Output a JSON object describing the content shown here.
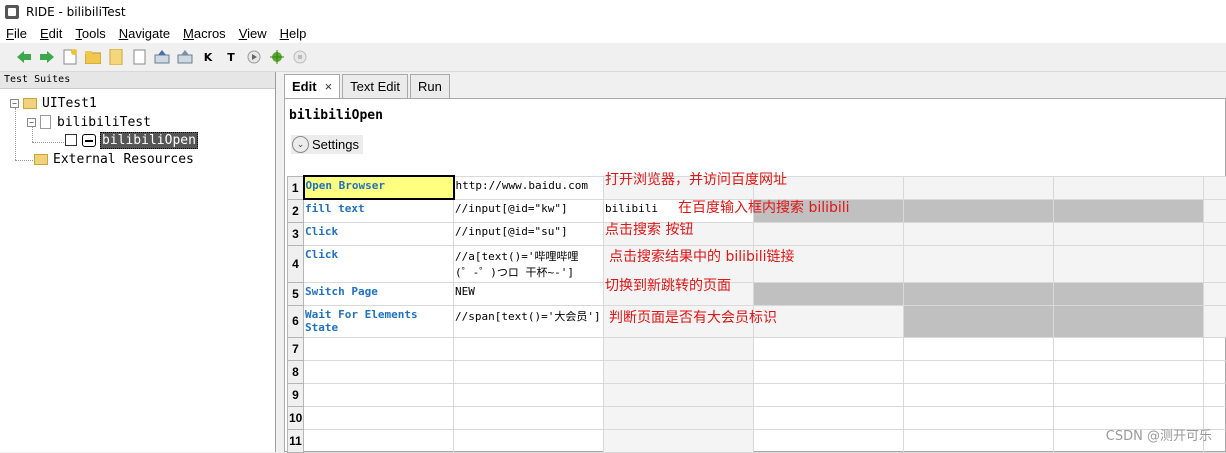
{
  "window": {
    "title": "RIDE - bilibiliTest"
  },
  "menu": [
    "File",
    "Edit",
    "Tools",
    "Navigate",
    "Macros",
    "View",
    "Help"
  ],
  "toolbar": {
    "icons": [
      "back-arrow-icon",
      "forward-arrow-icon",
      "new-project-icon",
      "open-folder-icon",
      "open-directory-icon",
      "new-file-icon",
      "save-icon",
      "save-all-icon",
      "search-keywords-icon",
      "search-tests-icon",
      "run-icon",
      "debug-bug-icon",
      "stop-icon"
    ],
    "k_label": "K",
    "t_label": "T"
  },
  "tree": {
    "header": "Test Suites",
    "project": "UITest1",
    "suite": "bilibiliTest",
    "testcase": "bilibiliOpen",
    "external": "External Resources"
  },
  "tabs": [
    {
      "label": "Edit"
    },
    {
      "label": "Text Edit"
    },
    {
      "label": "Run"
    }
  ],
  "editor": {
    "keyword_name": "bilibiliOpen",
    "settings_label": "Settings"
  },
  "grid_rows": [
    {
      "num": "1",
      "keyword": "Open Browser",
      "arg1": "http://www.baidu.com",
      "arg2": ""
    },
    {
      "num": "2",
      "keyword": "fill text",
      "arg1": "//input[@id=\"kw\"]",
      "arg2": "bilibili"
    },
    {
      "num": "3",
      "keyword": "Click",
      "arg1": "//input[@id=\"su\"]",
      "arg2": ""
    },
    {
      "num": "4",
      "keyword": "Click",
      "arg1": "//a[text()='哔哩哔哩 (゜-゜)つロ 干杯~-']",
      "arg2": ""
    },
    {
      "num": "5",
      "keyword": "Switch Page",
      "arg1": "NEW",
      "arg2": ""
    },
    {
      "num": "6",
      "keyword": "Wait For Elements State",
      "arg1": "//span[text()='大会员']",
      "arg2": ""
    },
    {
      "num": "7",
      "keyword": "",
      "arg1": "",
      "arg2": ""
    },
    {
      "num": "8",
      "keyword": "",
      "arg1": "",
      "arg2": ""
    },
    {
      "num": "9",
      "keyword": "",
      "arg1": "",
      "arg2": ""
    },
    {
      "num": "10",
      "keyword": "",
      "arg1": "",
      "arg2": ""
    },
    {
      "num": "11",
      "keyword": "",
      "arg1": "",
      "arg2": ""
    }
  ],
  "annotations": [
    "打开浏览器，并访问百度网址",
    "在百度输入框内搜索 bilibili",
    "点击搜索 按钮",
    "点击搜索结果中的 bilibili链接",
    "切换到新跳转的页面",
    "判断页面是否有大会员标识"
  ],
  "watermark": "CSDN @测开可乐",
  "colors": {
    "keyword": "#1f71c2",
    "annotation": "#e01515",
    "selected_cell": "#ffff80",
    "disabled_cell": "#c0c0c0"
  }
}
